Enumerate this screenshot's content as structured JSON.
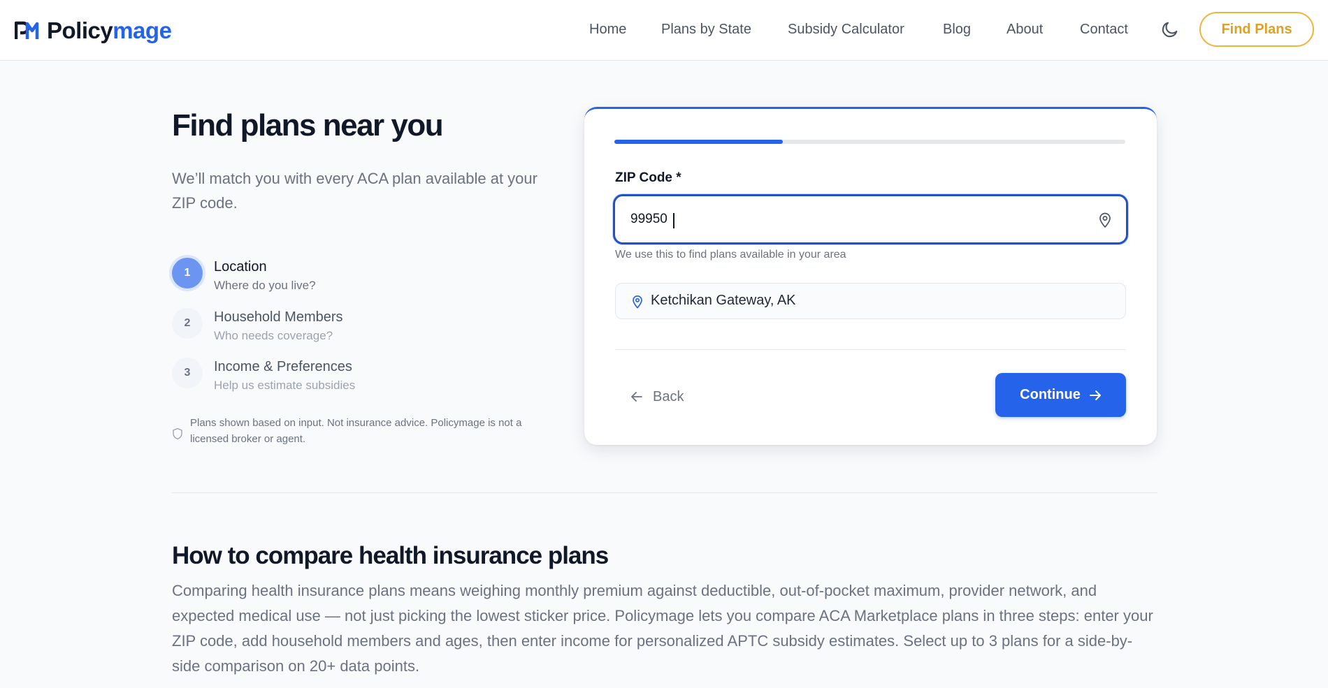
{
  "header": {
    "logo_part1": "Policy",
    "logo_part2": "mage",
    "nav": [
      "Home",
      "Plans by State",
      "Subsidy Calculator",
      "Blog",
      "About",
      "Contact"
    ],
    "cta": "Find Plans"
  },
  "intro": {
    "title": "Find plans near you",
    "subtitle": "We’ll match you with every ACA plan available at your ZIP code."
  },
  "steps": [
    {
      "num": "1",
      "title": "Location",
      "sub": "Where do you live?",
      "active": true
    },
    {
      "num": "2",
      "title": "Household Members",
      "sub": "Who needs coverage?",
      "active": false
    },
    {
      "num": "3",
      "title": "Income & Preferences",
      "sub": "Help us estimate subsidies",
      "active": false
    }
  ],
  "disclaimer": "Plans shown based on input. Not insurance advice. Policymage is not a licensed broker or agent.",
  "form": {
    "progress": 0.33,
    "zip_label": "ZIP Code *",
    "zip_value": "99950",
    "helper": "We use this to find plans available in your area",
    "location": "Ketchikan Gateway, AK",
    "back": "Back",
    "continue": "Continue"
  },
  "info": {
    "heading": "How to compare health insurance plans",
    "body": "Comparing health insurance plans means weighing monthly premium against deductible, out-of-pocket maximum, provider network, and expected medical use — not just picking the lowest sticker price. Policymage lets you compare ACA Marketplace plans in three steps: enter your ZIP code, add household members and ages, then enter income for personalized APTC subsidy estimates. Select up to 3 plans for a side-by-side comparison on 20+ data points."
  },
  "colors": {
    "accent": "#2563eb",
    "cta_border": "#f0b43c",
    "active_step": "#6b95f0"
  }
}
